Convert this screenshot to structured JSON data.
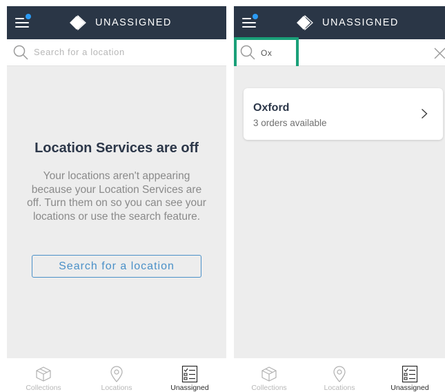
{
  "colors": {
    "header_bg": "#2a3646",
    "notification_dot": "#2b9bf4",
    "accent_blue": "#4a90c8",
    "highlight_green": "#1aa079",
    "content_bg": "#ededed"
  },
  "screens": [
    {
      "header": {
        "title": "UNASSIGNED",
        "menu_icon": "hamburger-menu-icon",
        "logo_icon": "diamond-logo-icon"
      },
      "search": {
        "placeholder": "Search for a location",
        "icon": "search-icon"
      },
      "empty_state": {
        "title": "Location Services are off",
        "body": "Your locations aren't appearing because your Location Services are off. Turn them on so you can see your locations or use the search feature.",
        "button_label": "Search for a location"
      },
      "tabs": [
        {
          "label": "Collections",
          "icon": "box-icon",
          "active": false
        },
        {
          "label": "Locations",
          "icon": "map-pin-icon",
          "active": false
        },
        {
          "label": "Unassigned",
          "icon": "checklist-icon",
          "active": true
        }
      ]
    },
    {
      "header": {
        "title": "UNASSIGNED",
        "menu_icon": "hamburger-menu-icon",
        "logo_icon": "diamond-logo-icon"
      },
      "search": {
        "value": "Ox",
        "icon": "search-icon",
        "clear_icon": "close-icon"
      },
      "results": [
        {
          "name": "Oxford",
          "subtitle": "3 orders available",
          "icon": "chevron-right-icon"
        }
      ],
      "tabs": [
        {
          "label": "Collections",
          "icon": "box-icon",
          "active": false
        },
        {
          "label": "Locations",
          "icon": "map-pin-icon",
          "active": false
        },
        {
          "label": "Unassigned",
          "icon": "checklist-icon",
          "active": true
        }
      ]
    }
  ]
}
